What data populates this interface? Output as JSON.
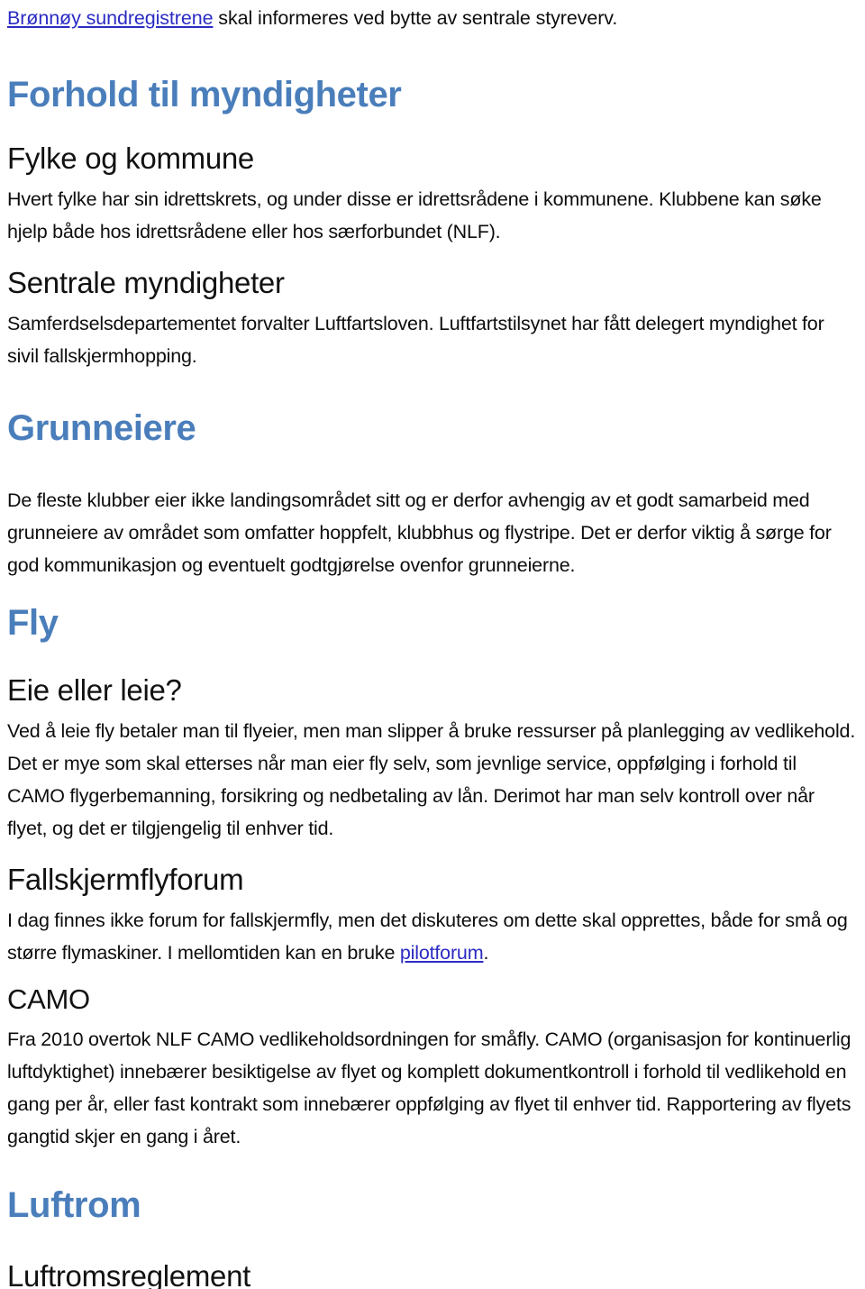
{
  "document": {
    "intro": {
      "link_text": "Brønnøy sundregistrene",
      "rest_text": " skal informeres ved bytte av sentrale styreverv."
    },
    "sections": [
      {
        "id": "forhold-til-myndigheter",
        "heading_level": 1,
        "heading": "Forhold til myndigheter",
        "subsections": [
          {
            "id": "fylke-og-kommune",
            "heading_level": 2,
            "heading": "Fylke og kommune",
            "body": "Hvert fylke har sin idrettskrets, og under disse er idrettsrådene i kommunene. Klubbene kan søke hjelp både hos idrettsrådene eller hos særforbundet (NLF)."
          },
          {
            "id": "sentrale-myndigheter",
            "heading_level": 2,
            "heading": "Sentrale myndigheter",
            "body": "Samferdselsdepartementet forvalter Luftfartsloven. Luftfartstilsynet har fått delegert myndighet for sivil fallskjermhopping."
          }
        ]
      },
      {
        "id": "grunneiere",
        "heading_level": 1,
        "heading": "Grunneiere",
        "body": "De fleste klubber eier ikke landingsområdet sitt og er derfor avhengig av et godt samarbeid med grunneiere av området som omfatter hoppfelt, klubbhus og flystripe. Det er derfor viktig å sørge for god kommunikasjon og eventuelt godtgjørelse ovenfor grunneierne.",
        "subsections": []
      },
      {
        "id": "fly",
        "heading_level": 1,
        "heading": "Fly",
        "subsections": [
          {
            "id": "eie-eller-leie",
            "heading_level": 2,
            "heading": "Eie eller leie?",
            "body_part_1": "Ved å leie fly betaler man til flyeier, men man slipper å bruke ressurser på planlegging av vedlikehold.",
            "body_part_2": "Det er mye som skal etterses når man eier fly selv, som jevnlige service, oppfølging i forhold til CAMO flygerbemanning, forsikring og nedbetaling av lån. Derimot har man selv kontroll over når flyet, og det er tilgjengelig til enhver tid."
          },
          {
            "id": "fallskjermflyforum",
            "heading_level": 2,
            "heading": "Fallskjermflyforum",
            "body_before_link": "I dag finnes ikke forum for fallskjermfly, men det diskuteres om dette skal opprettes, både for små og større flymaskiner. I mellomtiden kan en bruke ",
            "link_text": "pilotforum",
            "body_after_link": "."
          },
          {
            "id": "camo",
            "heading_level": 2,
            "heading": "CAMO",
            "body": "Fra 2010 overtok NLF CAMO vedlikeholdsordningen for småfly. CAMO (organisasjon for kontinuerlig luftdyktighet) innebærer besiktigelse av flyet og komplett dokumentkontroll i forhold til vedlikehold en gang per år, eller fast kontrakt som innebærer oppfølging av flyet til enhver tid. Rapportering av flyets gangtid skjer en gang i året."
          }
        ]
      },
      {
        "id": "luftrom",
        "heading_level": 1,
        "heading": "Luftrom",
        "subsections": [
          {
            "id": "luftromsreglement",
            "heading_level": 2,
            "heading": "Luftromsreglement"
          }
        ]
      }
    ]
  },
  "colors": {
    "heading_blue": "#4A7EBB",
    "link_blue": "#2B2BC4",
    "body_black": "#0D0D0D",
    "page_background": "#FFFFFF"
  }
}
